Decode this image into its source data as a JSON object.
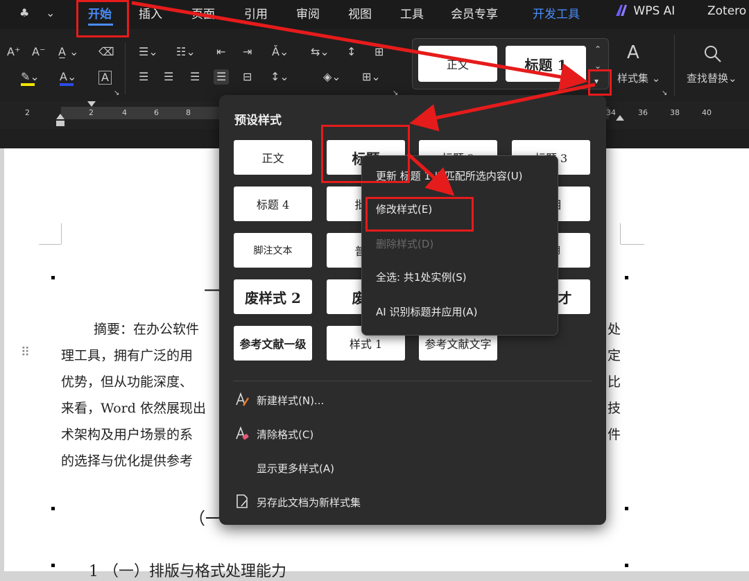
{
  "menu": {
    "tabs": [
      "开始",
      "插入",
      "页面",
      "引用",
      "审阅",
      "视图",
      "工具",
      "会员专享",
      "开发工具",
      "WPS AI",
      "Zotero"
    ],
    "active": "开始"
  },
  "ribbon": {
    "font_size_up": "A⁺",
    "font_size_down": "A⁻",
    "gallery": {
      "normal": "正文",
      "heading1": "标题 1"
    },
    "style_set_label": "样式集",
    "find_replace_label": "查找替换"
  },
  "ruler": {
    "numbers": [
      "2",
      "2",
      "4",
      "6",
      "8",
      "34",
      "36",
      "38",
      "40"
    ]
  },
  "document": {
    "lines": [
      "摘要：在办公软件",
      "理工具，拥有广泛的用",
      "优势，但从功能深度、",
      "来看，Word 依然展现出",
      "术架构及用户场景的系",
      "的选择与优化提供参考"
    ],
    "right_fragments": [
      "处",
      "定",
      "比",
      "技",
      "件"
    ],
    "heading_fragment": "一",
    "subheading_fragment": "（一",
    "bottom_fragment": "1  （一）排版与格式处理能力"
  },
  "style_panel": {
    "title": "预设样式",
    "tiles": [
      "正文",
      "标题",
      "标题 2",
      "标题 3",
      "标题 4",
      "批注",
      "…",
      "书目",
      "脚注文本",
      "普通",
      "…",
      "引用",
      "废样式 2",
      "废样",
      "…",
      "文献才",
      "参考文献一级",
      "样式 1",
      "参考文献文字"
    ],
    "bottom": {
      "new_style": "新建样式(N)...",
      "clear_format": "清除格式(C)",
      "more_styles": "显示更多样式(A)",
      "save_as": "另存此文档为新样式集"
    }
  },
  "context_menu": {
    "update": "更新 标题 1 以匹配所选内容(U)",
    "modify": "修改样式(E)",
    "delete": "删除样式(D)",
    "select_all": "全选: 共1处实例(S)",
    "ai_apply": "AI 识别标题并应用(A)"
  },
  "colors": {
    "accent": "#4a8cf7",
    "highlight_red": "#e61b1b"
  }
}
